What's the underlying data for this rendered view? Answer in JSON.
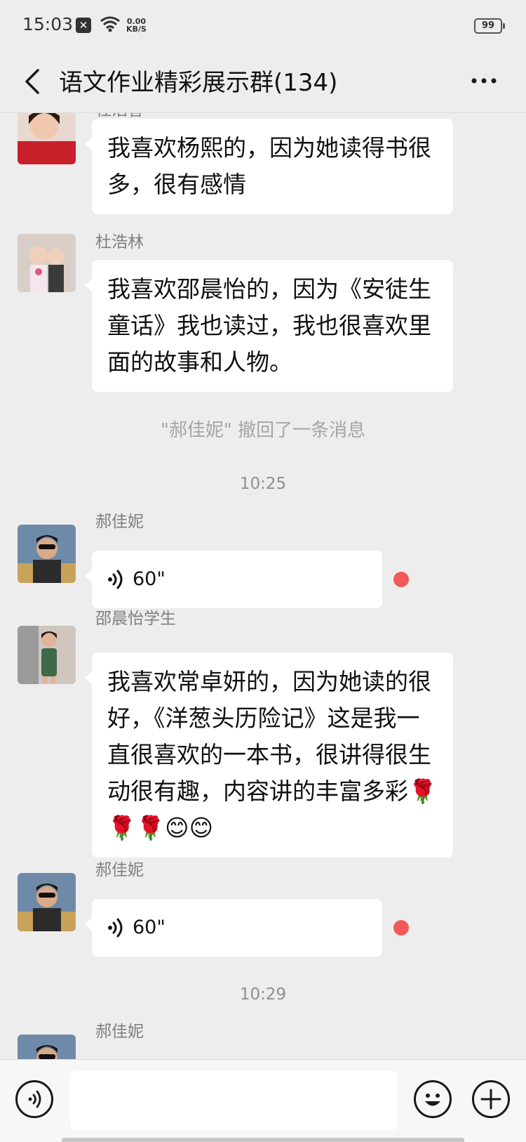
{
  "status": {
    "time": "15:03",
    "net_speed_value": "0.00",
    "net_speed_unit": "KB/S",
    "battery": "99"
  },
  "header": {
    "title": "语文作业精彩展示群(134)"
  },
  "messages": [
    {
      "sender": "杜浩昔",
      "text": "我喜欢杨熙的，因为她读得书很多，很有感情"
    },
    {
      "sender": "杜浩林",
      "text": "我喜欢邵晨怡的，因为《安徒生童话》我也读过，我也很喜欢里面的故事和人物。"
    },
    {
      "notice": "\"郝佳妮\" 撤回了一条消息"
    },
    {
      "timestamp": "10:25"
    },
    {
      "sender": "郝佳妮",
      "voice_duration": "60\""
    },
    {
      "sender": "邵晨怡学生",
      "text": "我喜欢常卓妍的，因为她读的很好，《洋葱头历险记》这是我一直很喜欢的一本书，很讲得很生动很有趣，内容讲的丰富多彩🌹🌹🌹😊😊"
    },
    {
      "sender": "郝佳妮",
      "voice_duration": "60\""
    },
    {
      "timestamp": "10:29"
    },
    {
      "sender": "郝佳妮"
    }
  ],
  "colors": {
    "background": "#ededed",
    "bubble": "#ffffff",
    "unread_dot": "#f25a5a"
  },
  "icons": [
    "back-icon",
    "more-icon",
    "voice-wave-icon",
    "voice-mode-icon",
    "emoji-icon",
    "plus-icon"
  ]
}
